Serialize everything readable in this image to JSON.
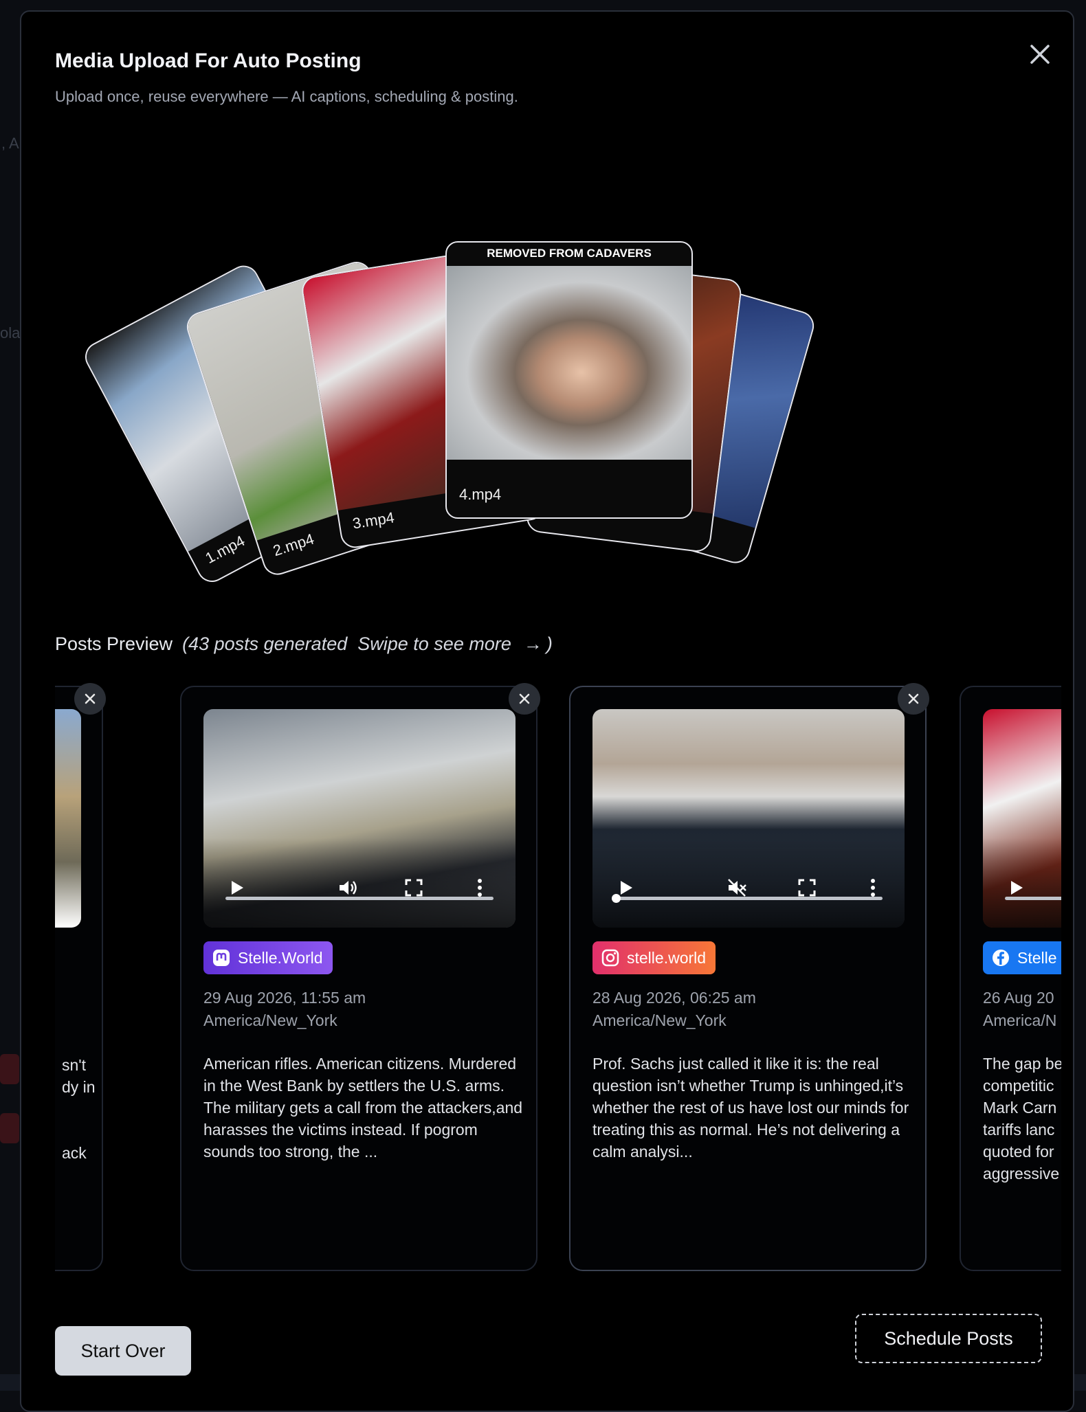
{
  "modal": {
    "title": "Media Upload For Auto Posting",
    "subtitle": "Upload once, reuse everywhere — AI captions, scheduling & posting."
  },
  "media_files": [
    {
      "name": "1.mp4"
    },
    {
      "name": "2.mp4"
    },
    {
      "name": "3.mp4"
    },
    {
      "name": "4.mp4",
      "banner": "REMOVED FROM CADAVERS"
    }
  ],
  "preview": {
    "heading": "Posts Preview",
    "count_text": "(43 posts generated",
    "swipe_text": "Swipe to see more",
    "close_paren": ")"
  },
  "posts": [
    {
      "platform": "mastodon",
      "account": "Stelle.World",
      "badge_color": "#6d3ee0",
      "date": "29 Aug 2026, 11:55 am",
      "timezone": "America/New_York",
      "body": "American rifles. American citizens. Murdered in the West Bank by settlers the U.S. arms. The military gets a call from the attackers,and harasses the victims instead. If pogrom sounds too strong, the ...",
      "muted": false
    },
    {
      "platform": "instagram",
      "account": "stelle.world",
      "badge_color": "#e1306c",
      "date": "28 Aug 2026, 06:25 am",
      "timezone": "America/New_York",
      "body": "Prof. Sachs just called it like it is: the real question isn’t whether Trump is unhinged,it’s whether the rest of us have lost our minds for treating this as normal. He’s not delivering a calm analysi...",
      "muted": true
    },
    {
      "platform": "facebook",
      "account": "Stelle",
      "badge_color": "#1877f2",
      "date": "26 Aug 20",
      "timezone": "America/N",
      "body": "The gap be competitic Mark Carn tariffs lanc quoted for aggressive"
    }
  ],
  "partial_left_post": {
    "lines": [
      "sn't",
      "dy in",
      "",
      "ack"
    ]
  },
  "buttons": {
    "start_over": "Start Over",
    "schedule": "Schedule Posts"
  }
}
